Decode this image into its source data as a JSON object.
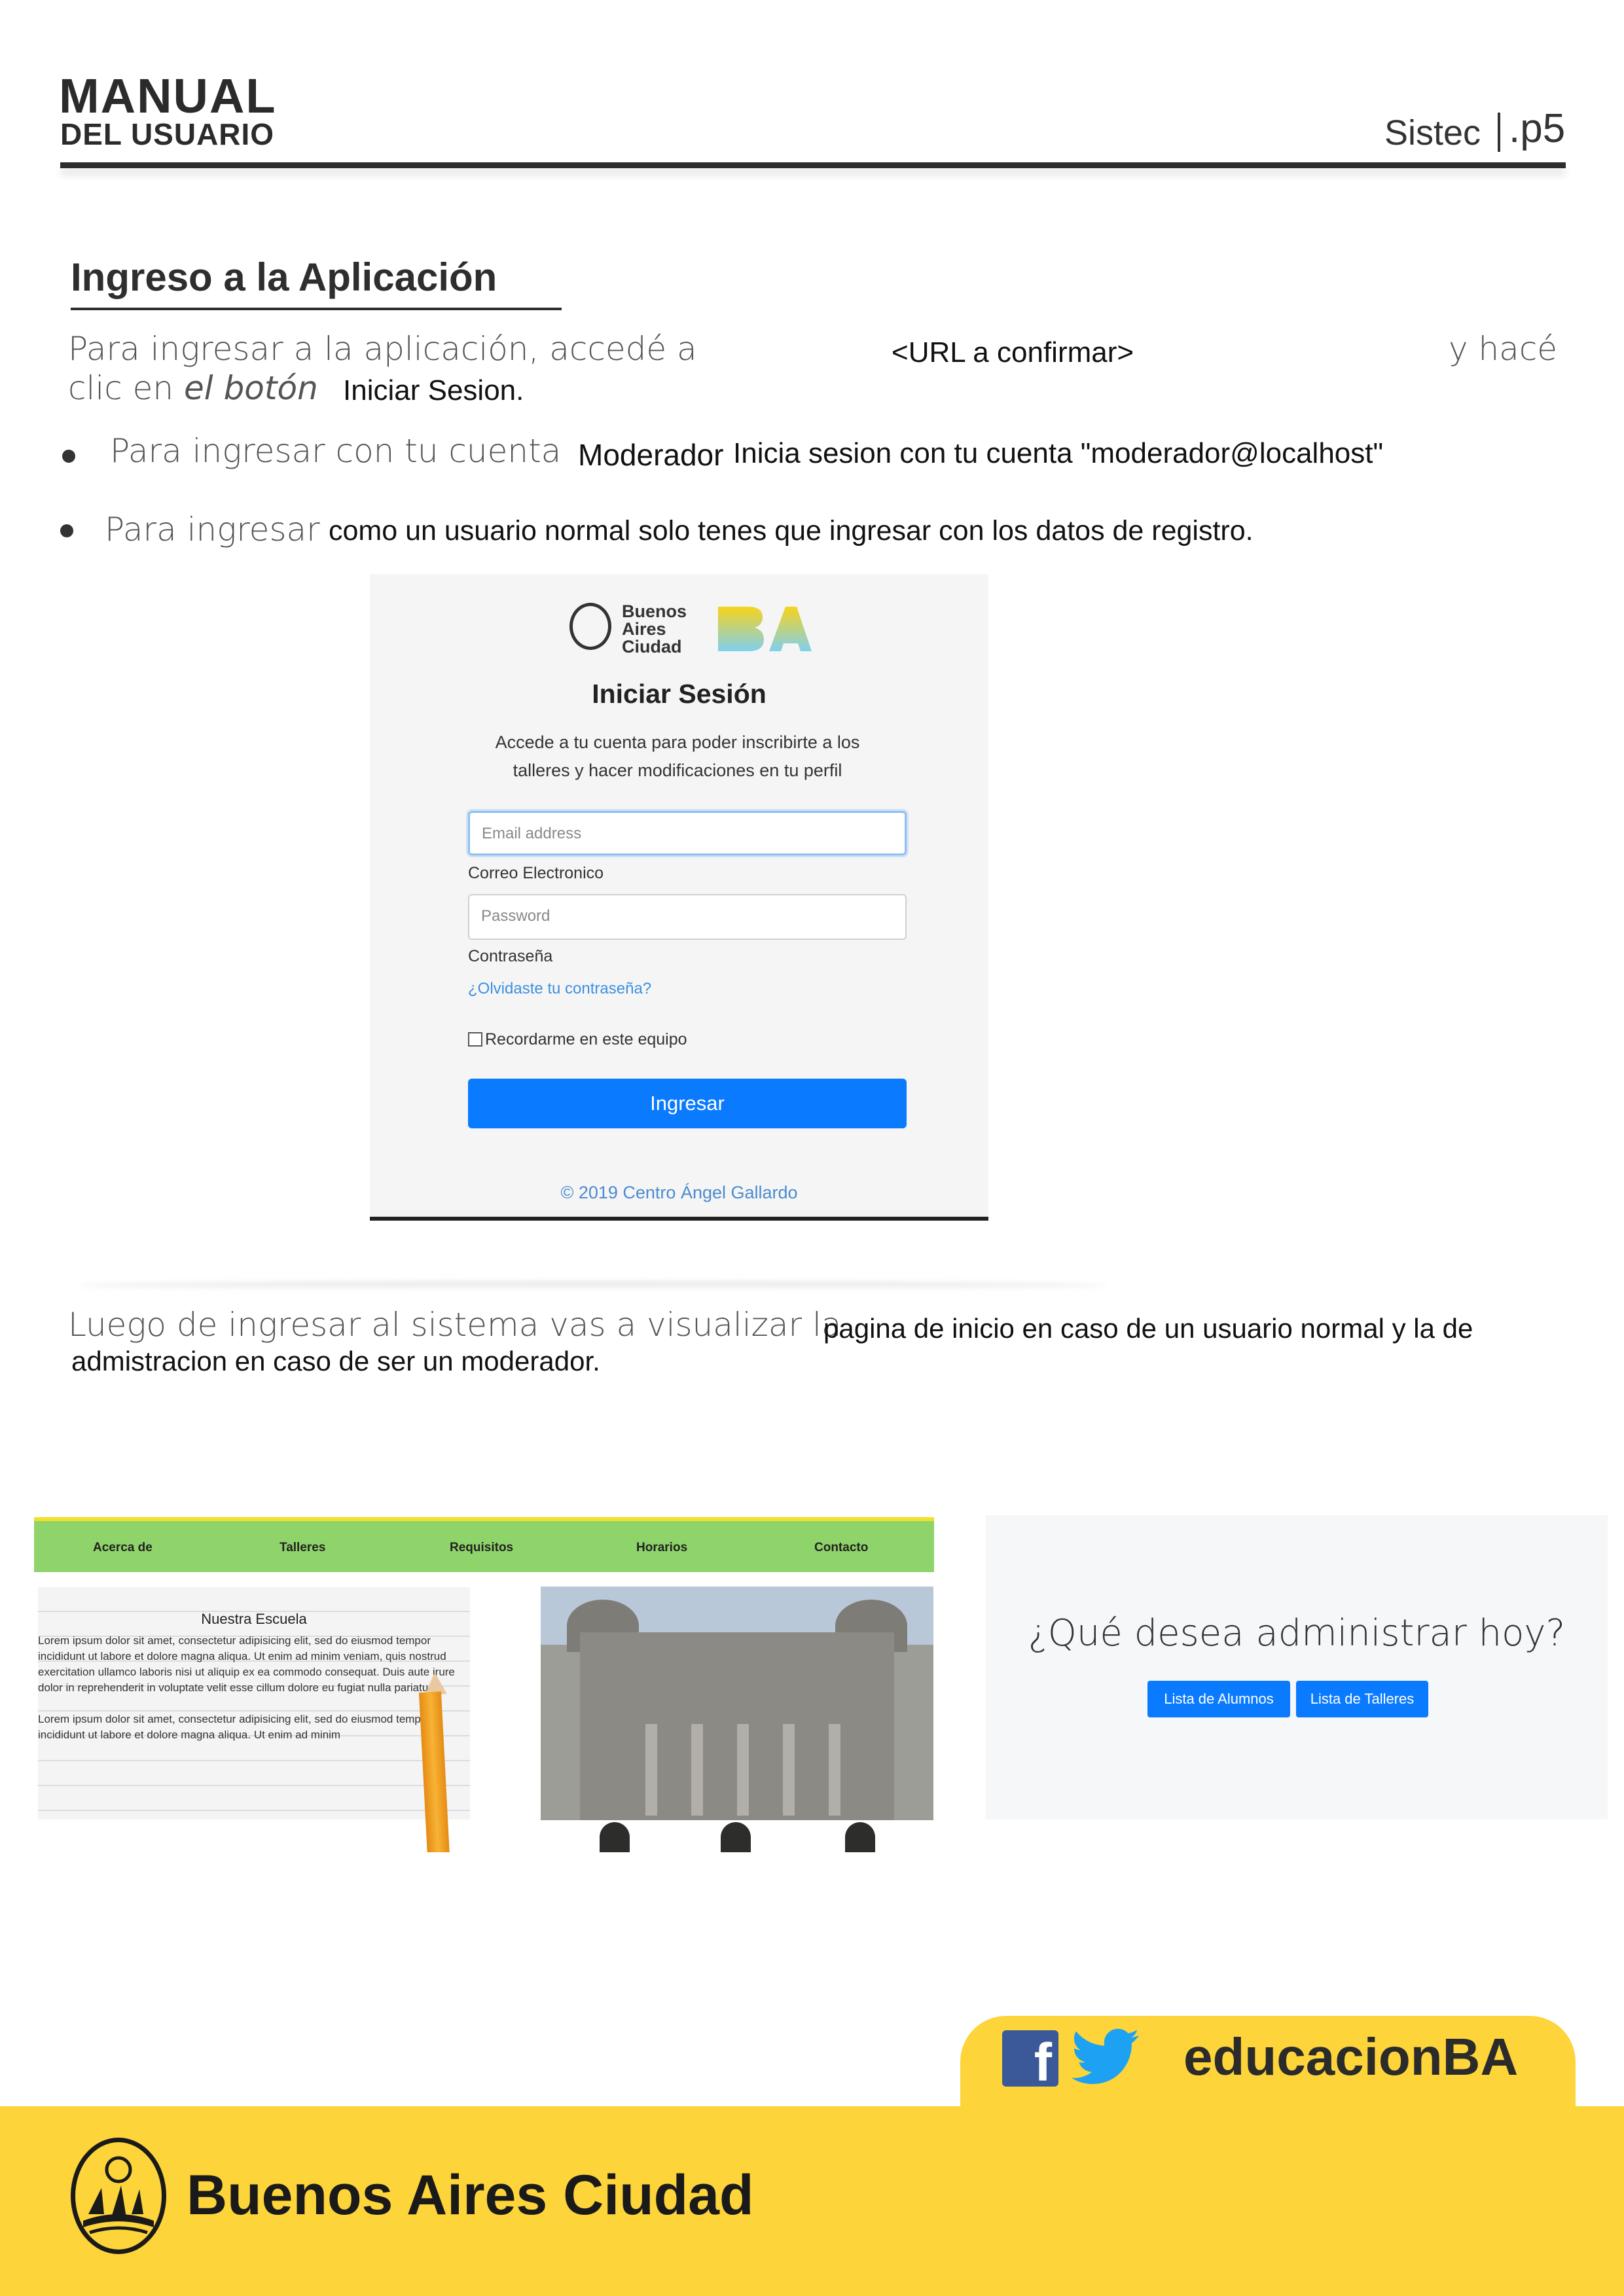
{
  "header": {
    "manual": "MANUAL",
    "del_usuario": "DEL USUARIO",
    "app": "Sistec",
    "page": ".p5"
  },
  "section": {
    "title": "Ingreso a la Aplicación",
    "intro_part1": "Para ingresar a la aplicación, accedé a",
    "intro_url": "<URL a confirmar>",
    "intro_part2": "y hacé",
    "intro_line2_a": "clic en",
    "intro_line2_b": "el botón",
    "intro_line2_c": "Iniciar Sesion.",
    "bullet1_a": "Para ingresar con tu cuenta",
    "bullet1_b": "Moderador",
    "bullet1_c": "Inicia sesion con tu cuenta \"moderador@localhost\"",
    "bullet2_a": "Para ingresar",
    "bullet2_b": "como un usuario normal solo tenes que ingresar con los datos de registro.",
    "after_a": "Luego de ingresar al sistema vas a visualizar la",
    "after_b": "pagina de inicio en caso de un usuario normal y la de",
    "after_c": "admistracion en caso de ser un moderador."
  },
  "login": {
    "logo_text": [
      "Buenos",
      "Aires",
      "Ciudad"
    ],
    "title": "Iniciar Sesión",
    "subtitle": "Accede a tu cuenta para poder inscribirte a los talleres y hacer modificaciones en tu perfil",
    "email_placeholder": "Email address",
    "email_label": "Correo Electronico",
    "password_placeholder": "Password",
    "password_label": "Contraseña",
    "forgot": "¿Olvidaste tu contraseña?",
    "remember": "Recordarme en este equipo",
    "submit": "Ingresar",
    "copyright": "© 2019 Centro Ángel Gallardo",
    "colors": {
      "primary": "#0a7bff",
      "link": "#3d8fe0"
    }
  },
  "home": {
    "nav": [
      "Acerca de",
      "Talleres",
      "Requisitos",
      "Horarios",
      "Contacto"
    ],
    "panel_title": "Nuestra Escuela",
    "panel_text1": "Lorem ipsum dolor sit amet, consectetur adipisicing elit, sed do eiusmod tempor incididunt ut labore et dolore magna aliqua. Ut enim ad minim veniam, quis nostrud exercitation ullamco laboris nisi ut aliquip ex ea commodo consequat. Duis aute irure dolor in reprehenderit in voluptate velit esse cillum dolore eu fugiat nulla pariatur.",
    "panel_text2": "Lorem ipsum dolor sit amet, consectetur adipisicing elit, sed do eiusmod tempor incididunt ut labore et dolore magna aliqua. Ut enim ad minim",
    "colors": {
      "nav": "#8fd46a"
    }
  },
  "admin": {
    "title": "¿Qué desea administrar hoy?",
    "btn_alumnos": "Lista de Alumnos",
    "btn_talleres": "Lista de Talleres"
  },
  "footer": {
    "social_handle": "educacionBA",
    "brand": "Buenos Aires Ciudad",
    "colors": {
      "yellow": "#fdd439"
    }
  }
}
